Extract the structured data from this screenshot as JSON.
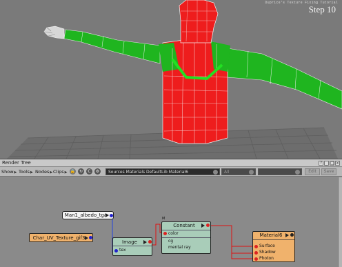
{
  "viewport": {
    "tutorial_title": "Duprice's Texture Fixing Tutorial",
    "step_label": "Step 10",
    "colors": {
      "mesh_red": "#ee1d1d",
      "mesh_green": "#1fb51f",
      "seam_highlight": "#22e022",
      "grid": "#5c5c5c",
      "background": "#7a7a7a"
    }
  },
  "render_tree": {
    "title": "Render Tree",
    "window_buttons": [
      "?",
      "_",
      "□",
      "x"
    ],
    "menus": [
      {
        "label": "Show"
      },
      {
        "label": "Tools"
      },
      {
        "label": "Nodes"
      },
      {
        "label": "Clips"
      }
    ],
    "toolbar_icons": [
      "lock-icon",
      "refresh-icon",
      "c-icon",
      "settings-icon"
    ],
    "path_field": "Sources Materials DefaultLib Material6",
    "filter_select": "All",
    "search_placeholder": "",
    "edit_button": "Edit",
    "save_button": "Save",
    "nodes": {
      "albedo": {
        "label": "Man1_albedo_tga"
      },
      "char": {
        "label": "Char_UV_Texture_gif3"
      },
      "image": {
        "label": "Image",
        "input": "tex"
      },
      "constant": {
        "label": "Constant",
        "marker": "M",
        "ports": [
          "color",
          "cg",
          "mental ray"
        ]
      },
      "material": {
        "label": "Material6",
        "ports": [
          "Surface",
          "Shadow",
          "Photon"
        ]
      }
    },
    "colors": {
      "texture_node": "#f0b26c",
      "shader_node": "#a9cdb9",
      "clip_node": "#f4f4f4",
      "connection_red": "#dd1111",
      "connection_blue": "#2244dd"
    }
  }
}
